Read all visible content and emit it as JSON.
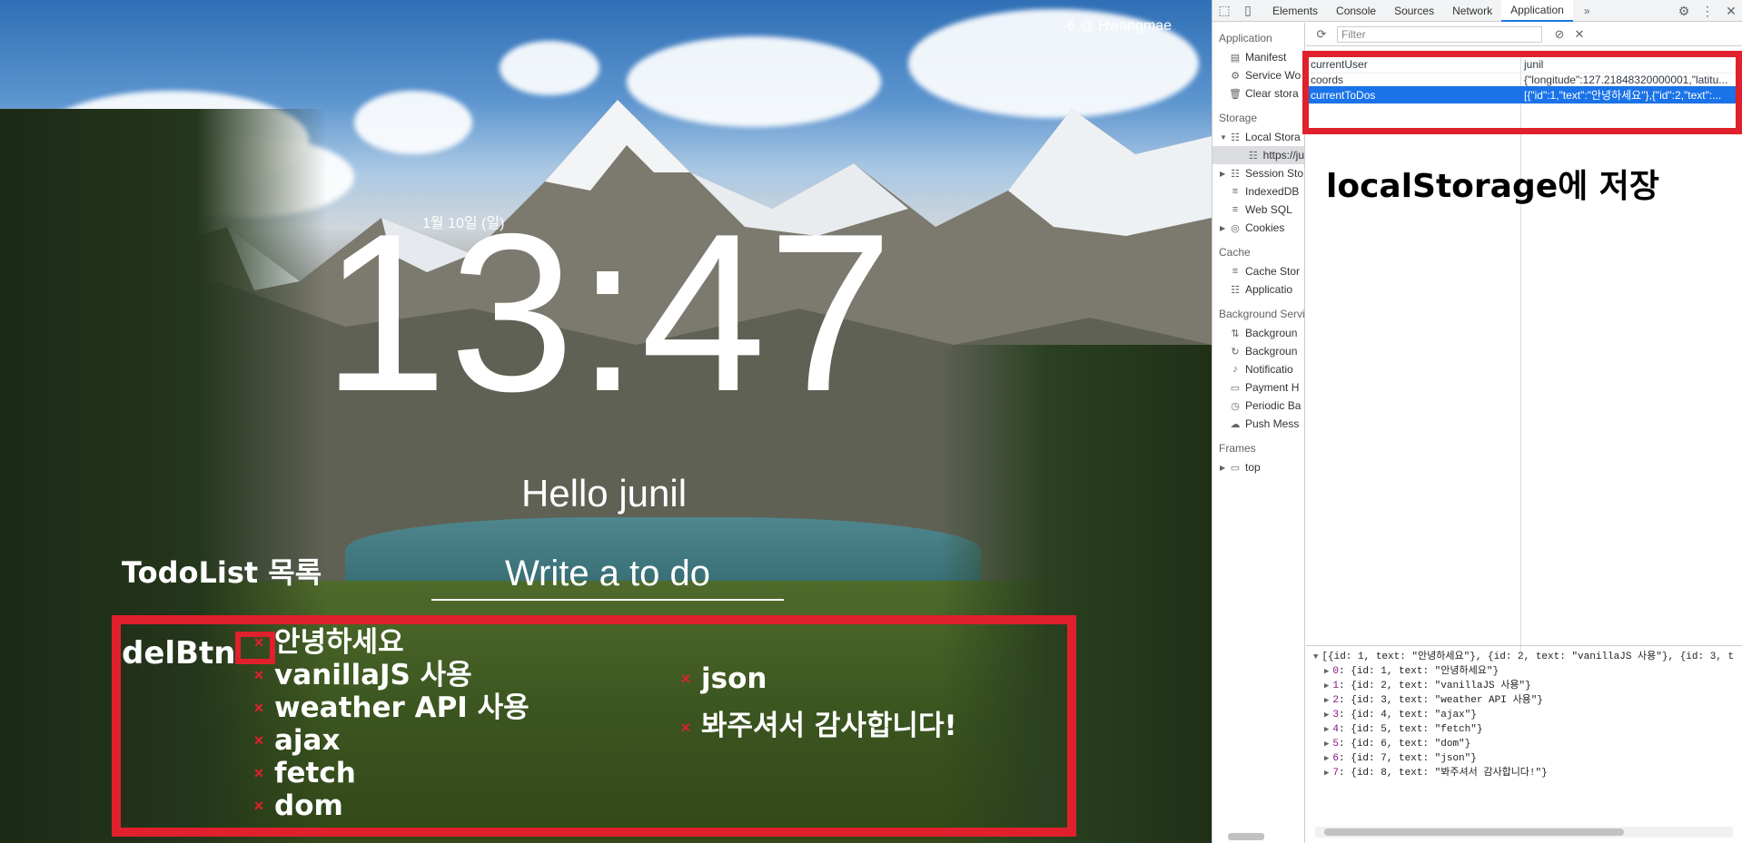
{
  "app": {
    "weather": "-6 @ Hwangmae",
    "date": "1월 10일 (일)",
    "clock": "13:47",
    "greeting": "Hello junil",
    "todo_heading": "TodoList 목록",
    "todo_placeholder": "Write a to do",
    "delbtn_label": "delBtn",
    "del_glyph": "×",
    "todos_left": [
      "안녕하세요",
      "vanillaJS 사용",
      "weather API 사용",
      "ajax",
      "fetch",
      "dom"
    ],
    "todos_right": [
      "json",
      "봐주셔서 감사합니다!"
    ]
  },
  "devtools": {
    "tabs": [
      "Elements",
      "Console",
      "Sources",
      "Network",
      "Application"
    ],
    "active_tab": "Application",
    "more_tabs": "»",
    "sidebar": {
      "application_section": "Application",
      "application_items": [
        "Manifest",
        "Service Wo",
        "Clear stora"
      ],
      "storage_section": "Storage",
      "storage_items": [
        "Local Stora",
        "https://ju",
        "Session Sto",
        "IndexedDB",
        "Web SQL",
        "Cookies"
      ],
      "cache_section": "Cache",
      "cache_items": [
        "Cache Stor",
        "Applicatio"
      ],
      "background_section": "Background Servi",
      "background_items": [
        "Backgroun",
        "Backgroun",
        "Notificatio",
        "Payment H",
        "Periodic Ba",
        "Push Mess"
      ],
      "frames_section": "Frames",
      "frames_items": [
        "top"
      ]
    },
    "filter_placeholder": "Filter",
    "local_storage": [
      {
        "key": "currentUser",
        "value": "junil"
      },
      {
        "key": "coords",
        "value": "{\"longitude\":127.21848320000001,\"latitu..."
      },
      {
        "key": "currentToDos",
        "value": "[{\"id\":1,\"text\":\"안녕하세요\"},{\"id\":2,\"text\":..."
      }
    ],
    "selected_row": 2,
    "annotation_note": "localStorage에 저장",
    "console": {
      "summary": "[{id: 1, text: \"안녕하세요\"}, {id: 2, text: \"vanillaJS 사용\"}, {id: 3, t",
      "entries": [
        {
          "idx": "0",
          "val": "{id: 1, text: \"안녕하세요\"}"
        },
        {
          "idx": "1",
          "val": "{id: 2, text: \"vanillaJS 사용\"}"
        },
        {
          "idx": "2",
          "val": "{id: 3, text: \"weather API 사용\"}"
        },
        {
          "idx": "3",
          "val": "{id: 4, text: \"ajax\"}"
        },
        {
          "idx": "4",
          "val": "{id: 5, text: \"fetch\"}"
        },
        {
          "idx": "5",
          "val": "{id: 6, text: \"dom\"}"
        },
        {
          "idx": "6",
          "val": "{id: 7, text: \"json\"}"
        },
        {
          "idx": "7",
          "val": "{id: 8, text: \"봐주셔서 감사합니다!\"}"
        }
      ]
    }
  }
}
